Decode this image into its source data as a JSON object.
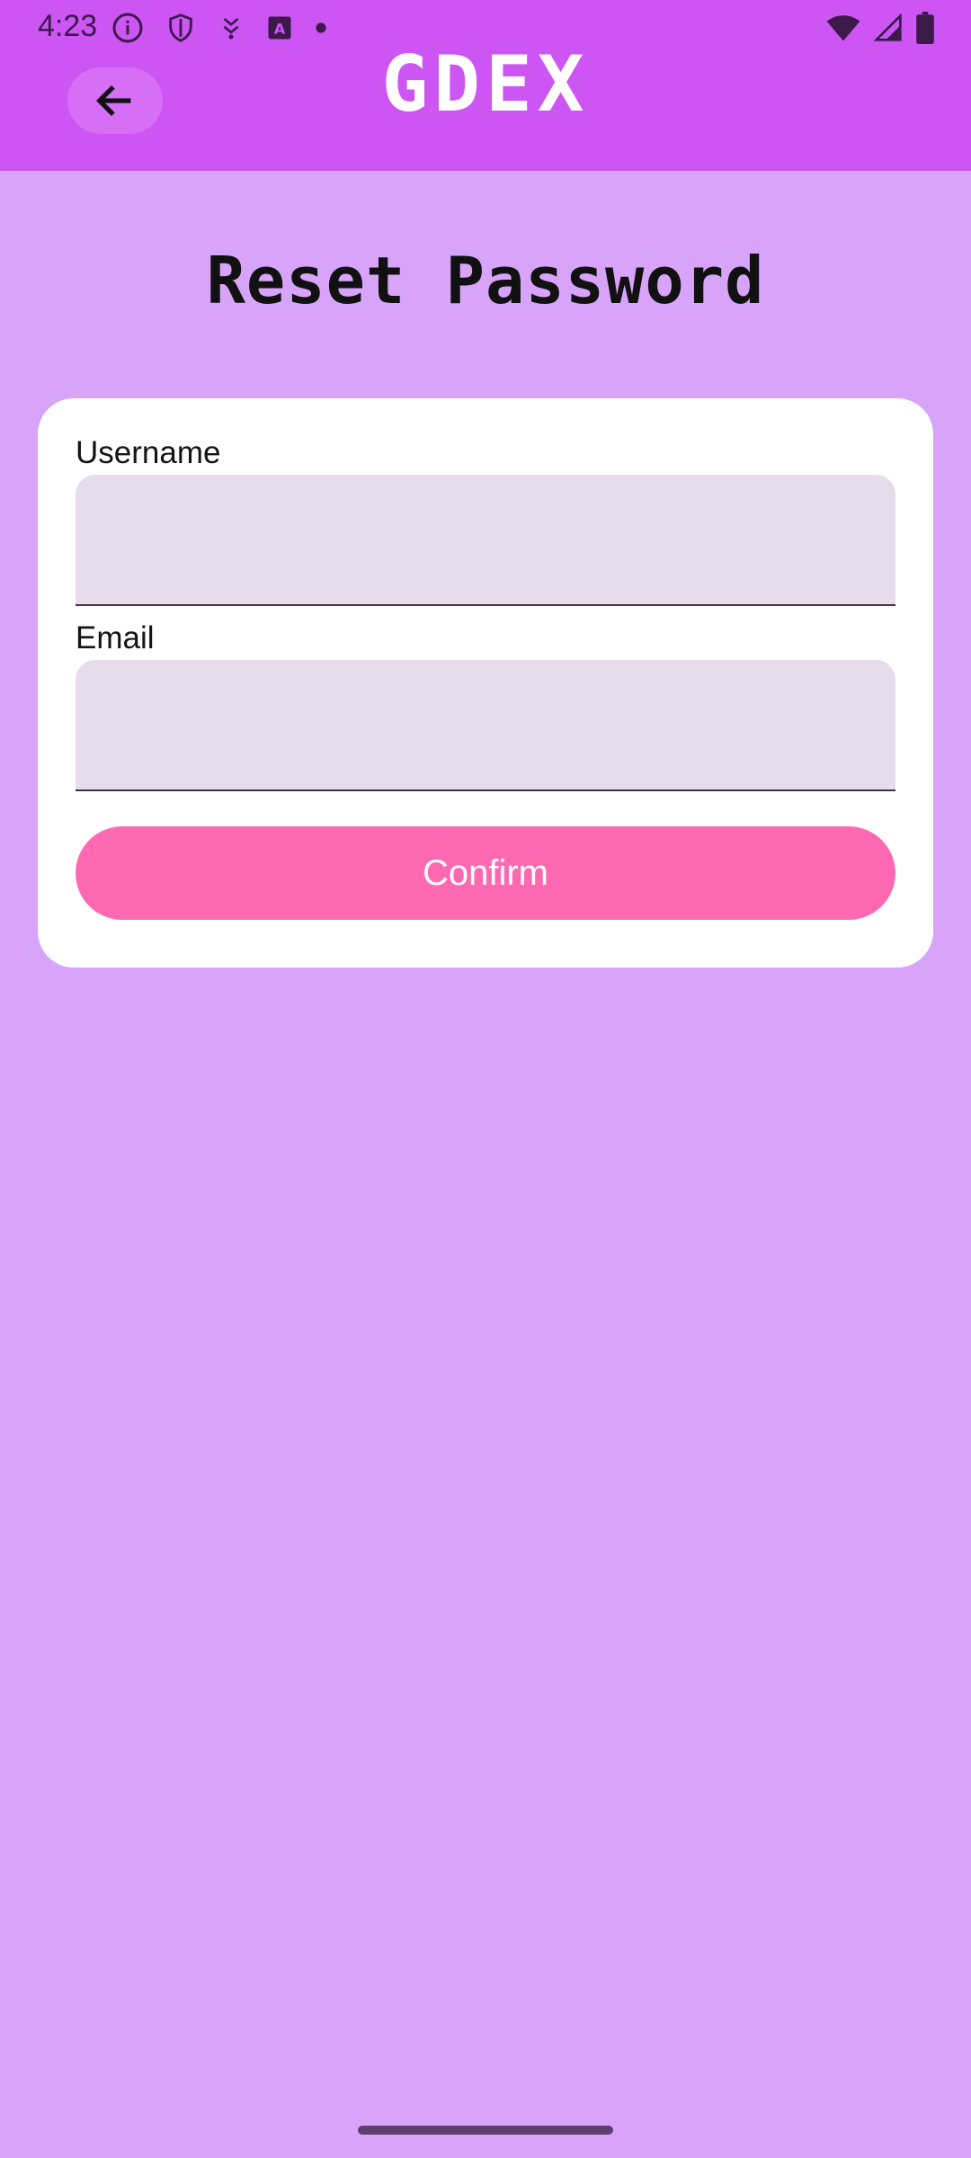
{
  "status_bar": {
    "time": "4:23"
  },
  "app_bar": {
    "brand": "GDEX"
  },
  "page": {
    "title": "Reset Password"
  },
  "form": {
    "username_label": "Username",
    "username_value": "",
    "email_label": "Email",
    "email_value": "",
    "confirm_label": "Confirm"
  },
  "colors": {
    "app_bar": "#cd55f3",
    "background": "#d8a4fa",
    "card": "#ffffff",
    "input_fill": "#e6dcec",
    "confirm_button": "#ff69b2"
  },
  "icons": {
    "back": "arrow-left-icon",
    "status_info": "info-icon",
    "status_shield": "shield-icon",
    "status_download": "download-icon",
    "status_a": "a-box-icon",
    "status_dot": "dot-icon",
    "wifi": "wifi-icon",
    "signal": "signal-icon",
    "battery": "battery-icon"
  }
}
